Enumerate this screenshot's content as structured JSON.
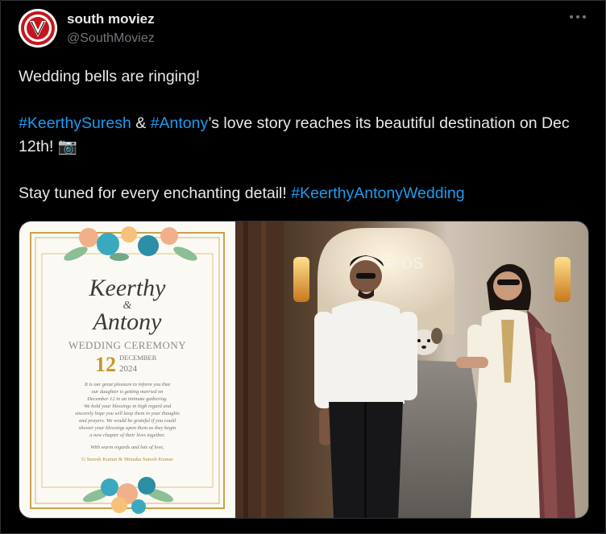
{
  "author": {
    "display_name": "south moviez",
    "handle": "@SouthMoviez",
    "avatar_icon": "avatar-v-logo"
  },
  "more_icon": "more-options-icon",
  "tweet": {
    "line1": "Wedding bells are ringing!",
    "hashtag1": "#KeerthySuresh",
    "amp": " & ",
    "hashtag2": "#Antony",
    "line2_rest": "’s love story reaches its beautiful destination on Dec 12th! ",
    "camera_emoji": "📷",
    "line3_text": "Stay tuned for every enchanting detail! ",
    "hashtag3": "#KeerthyAntonyWedding"
  },
  "media": {
    "invitation": {
      "name1": "Keerthy",
      "ampersand": "&",
      "name2": "Antony",
      "ceremony": "WEDDING CEREMONY",
      "day": "12",
      "month": "DECEMBER",
      "year": "2024",
      "message": [
        "It is our great pleasure to inform you that",
        "our daughter is getting married on",
        "December 12 in an intimate gathering.",
        "We hold your blessings in high regard and",
        "sincerely hope you will keep them in your thoughts",
        "and prayers. We would be grateful if you could",
        "shower your blessings upon them as they begin",
        "a new chapter of their lives together."
      ],
      "regards": "With warm regards and lots of love,",
      "parents": "G Suresh Kumar & Menaka Suresh Kumar"
    },
    "sign_text": "asperos"
  },
  "colors": {
    "link": "#1d9bf0",
    "text": "#e7e9ea",
    "muted": "#71767b",
    "background": "#000000",
    "gold": "#b8923e",
    "teal": "#2aa7b8"
  }
}
